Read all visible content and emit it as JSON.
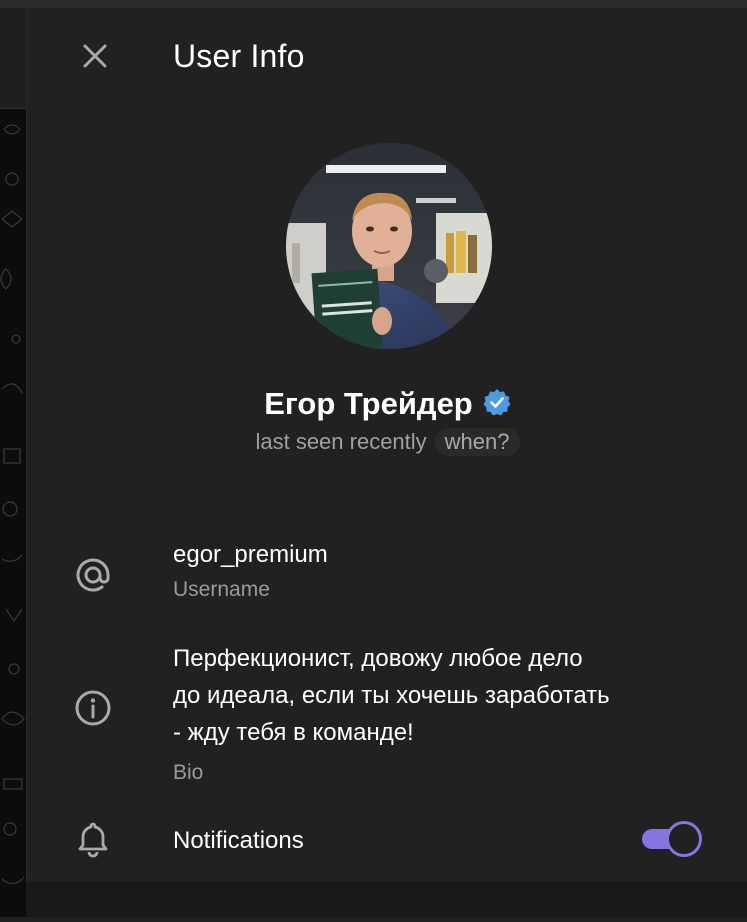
{
  "header": {
    "title": "User Info"
  },
  "profile": {
    "name": "Егор Трейдер",
    "status": "last seen recently",
    "status_link": "when?",
    "verified": true
  },
  "info": {
    "username_value": "egor_premium",
    "username_label": "Username",
    "bio_lines": [
      "Перфекционист, довожу любое дело",
      "до идеала, если ты хочешь заработать",
      "- жду тебя в команде!"
    ],
    "bio_label": "Bio",
    "notifications_label": "Notifications",
    "notifications_enabled": true
  },
  "icons": {
    "close": "close-icon",
    "verified": "verified-badge-icon",
    "username": "at-sign-icon",
    "bio": "info-icon",
    "notifications": "bell-icon"
  },
  "colors": {
    "background": "#212121",
    "accent": "#8774e1",
    "verified": "#4c9ce2",
    "secondary_text": "#9a9a9a"
  }
}
